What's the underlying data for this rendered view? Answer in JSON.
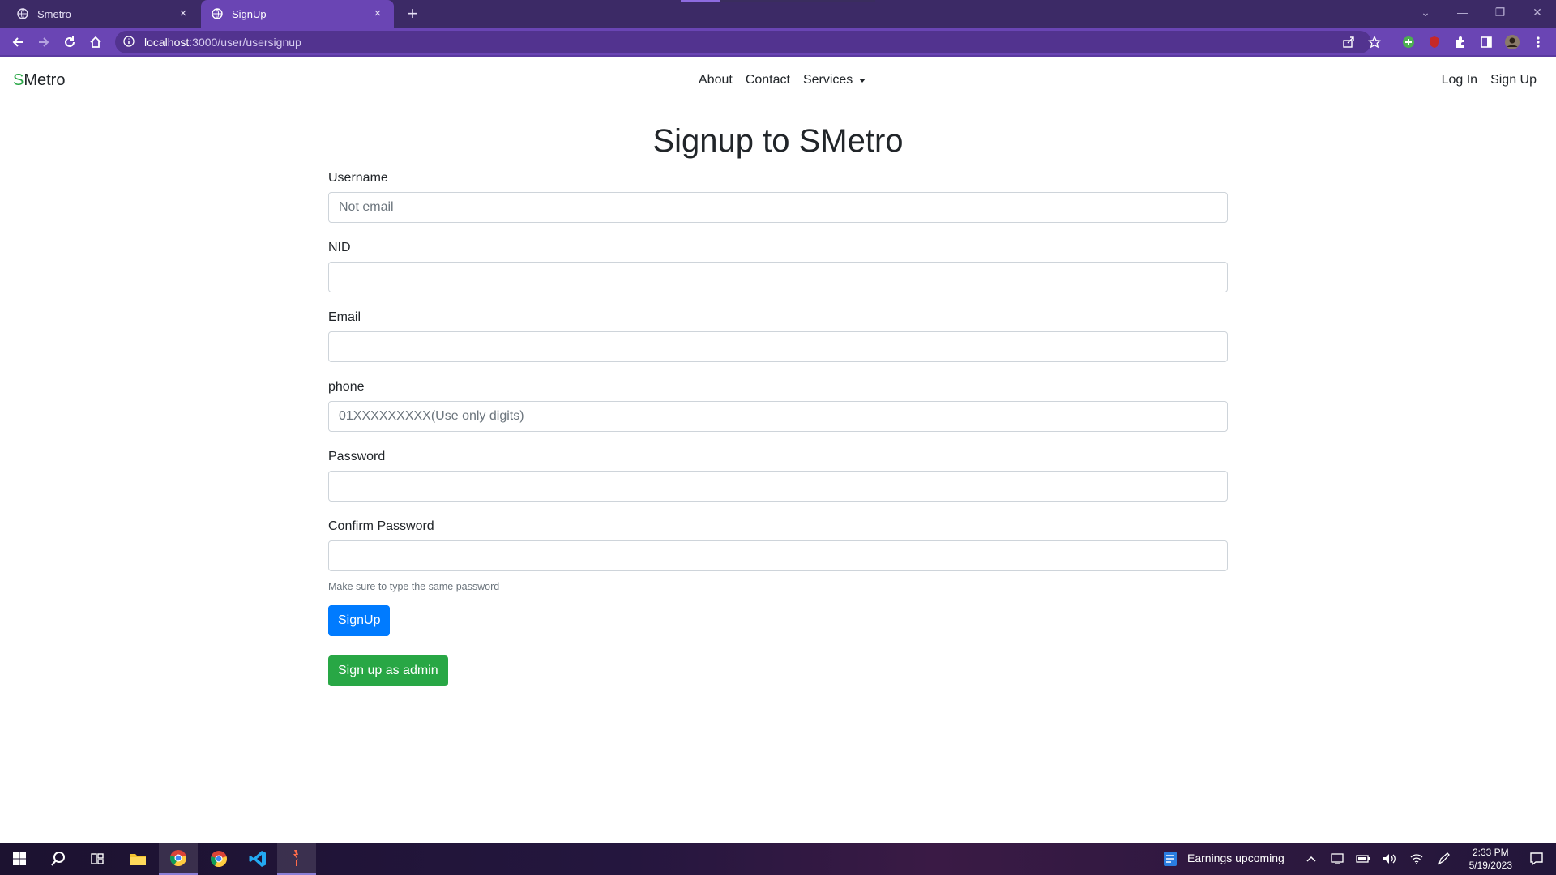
{
  "browser": {
    "tabs": [
      {
        "title": "Smetro",
        "close": "×"
      },
      {
        "title": "SignUp",
        "close": "×"
      }
    ],
    "new_tab": "+",
    "url_host": "localhost",
    "url_rest": ":3000/user/usersignup"
  },
  "navbar": {
    "brand_first": "S",
    "brand_rest": "Metro",
    "links": [
      "About",
      "Contact",
      "Services"
    ],
    "auth": [
      "Log In",
      "Sign Up"
    ]
  },
  "page": {
    "title": "Signup to SMetro",
    "fields": [
      {
        "label": "Username",
        "placeholder": "Not email"
      },
      {
        "label": "NID",
        "placeholder": ""
      },
      {
        "label": "Email",
        "placeholder": ""
      },
      {
        "label": "phone",
        "placeholder": "01XXXXXXXXX(Use only digits)"
      },
      {
        "label": "Password",
        "placeholder": ""
      },
      {
        "label": "Confirm Password",
        "placeholder": ""
      }
    ],
    "help_text": "Make sure to type the same password",
    "signup_button": "SignUp",
    "admin_button": "Sign up as admin"
  },
  "taskbar": {
    "news": "Earnings upcoming",
    "time": "2:33 PM",
    "date": "5/19/2023"
  },
  "colors": {
    "primary": "#007bff",
    "success": "#28a745",
    "chrome": "#6a45b4"
  }
}
